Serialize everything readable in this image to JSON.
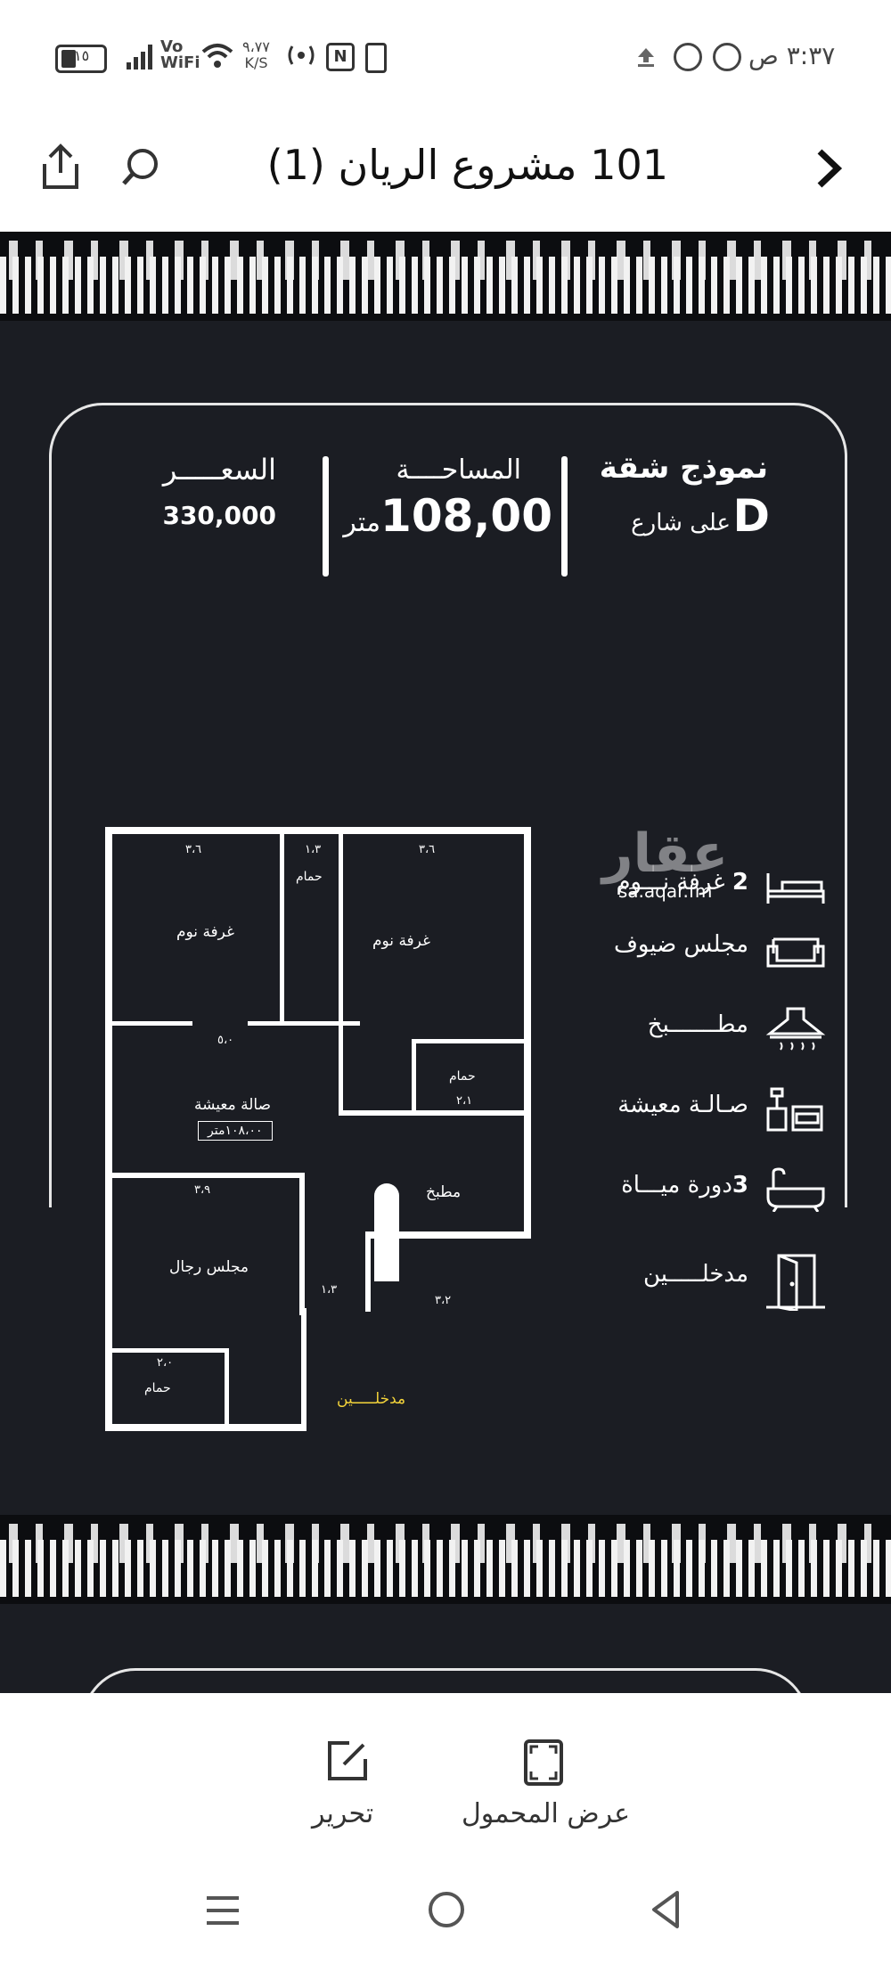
{
  "status_bar": {
    "time": "٣:٣٧ ص",
    "battery": "١٥",
    "network_speed_top": "٩،٧٧",
    "network_speed_unit": "K/S",
    "wifi_label_top": "Vo",
    "wifi_label_bottom": "WiFi"
  },
  "header": {
    "title": "101 مشروع الريان (1)",
    "back_icon": "chevron-right-icon",
    "search_icon": "search-icon",
    "share_icon": "share-icon"
  },
  "listing": {
    "model_title": "نموذج شقة",
    "model_letter": "D",
    "model_sub": "على شارع",
    "area_title": "المساحــــة",
    "area_value": "108,00",
    "area_unit": "متر",
    "price_title": "السعـــــر",
    "price_value": "330,000"
  },
  "watermark": {
    "brand": "عقار",
    "url": "sa.aqar.fm"
  },
  "features": [
    {
      "icon": "bed-icon",
      "count": "2",
      "label": "غرفة نـــوم"
    },
    {
      "icon": "sofa-icon",
      "count": "",
      "label": "مجلس ضيوف"
    },
    {
      "icon": "stove-hood-icon",
      "count": "",
      "label": "مطـــــــبخ"
    },
    {
      "icon": "living-room-icon",
      "count": "",
      "label": "صـالـة معيشة"
    },
    {
      "icon": "bathtub-icon",
      "count": "3",
      "label": "دورة ميـــاة"
    },
    {
      "icon": "door-icon",
      "count": "",
      "label": "مدخلـــــين"
    }
  ],
  "plan": {
    "bedroom1": "غرفة نوم",
    "bedroom2": "غرفة نوم",
    "bath1": "حمام",
    "bath2": "حمام",
    "bath3": "حمام",
    "living": "صالة معيشة",
    "living_area": "١٠٨،٠٠متر",
    "kitchen": "مطبخ",
    "majlis": "مجلس رجال",
    "entrance": "مدخلـــــين",
    "dims": {
      "d1": "٣،٦",
      "d2": "١،٣",
      "d3": "٣،٦",
      "d4": "٥،٠",
      "d5": "٢،١",
      "d6": "٣،٩",
      "d7": "٣،٢",
      "d8": "١،٣",
      "d9": "٢،٠"
    }
  },
  "toolbar": {
    "edit_label": "تحرير",
    "edit_icon": "edit-icon",
    "fullscreen_label": "عرض المحمول",
    "fullscreen_icon": "fullscreen-icon"
  },
  "navbar": {
    "menu_icon": "menu-icon",
    "home_icon": "home-circle-icon",
    "back_icon": "back-triangle-icon"
  }
}
